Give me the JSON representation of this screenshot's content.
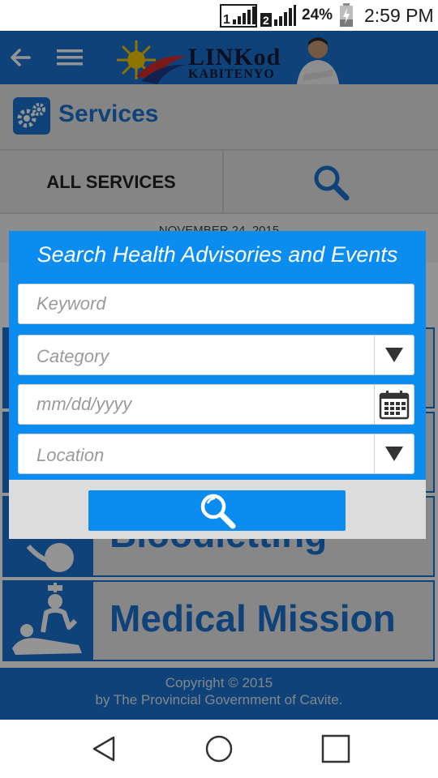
{
  "status_bar": {
    "sim1_label": "1",
    "sim2_label": "2",
    "battery_percent": "24%",
    "time": "2:59 PM"
  },
  "app_bar": {
    "logo_line1": "LINKod",
    "logo_line2": "KABITENYO"
  },
  "page": {
    "title": "Services"
  },
  "tabs": {
    "all_services": "ALL SERVICES"
  },
  "date_strip": "NOVEMBER 24, 2015",
  "services": [
    {
      "label": ""
    },
    {
      "label": ""
    },
    {
      "label": "Bloodletting"
    },
    {
      "label": "Medical Mission"
    }
  ],
  "footer": {
    "line1": "Copyright © 2015",
    "line2": "by The Provincial Government of Cavite."
  },
  "dialog": {
    "title": "Search Health Advisories and Events",
    "keyword_placeholder": "Keyword",
    "category_placeholder": "Category",
    "date_placeholder": "mm/dd/yyyy",
    "location_placeholder": "Location"
  },
  "colors": {
    "brand_blue": "#1a73d0",
    "dialog_blue": "#0b8cf0"
  }
}
